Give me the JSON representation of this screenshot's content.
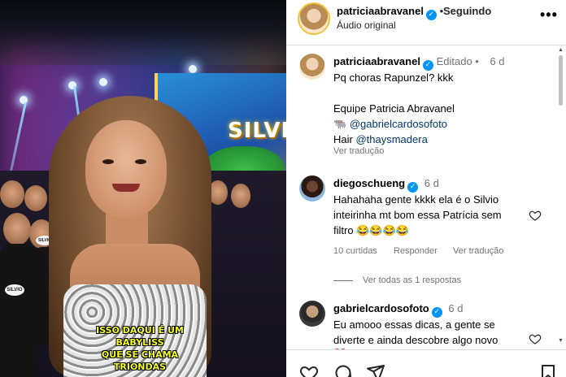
{
  "post": {
    "username": "patriciaabravanel",
    "follow_status": "Seguindo",
    "audio": "Áudio original",
    "more": "•••"
  },
  "video": {
    "sign_text": "SILVIO",
    "caption_line1": "ISSO DAQUI É UM BABYLISS",
    "caption_line2": "QUE SE CHAMA TRIONDAS",
    "badge_1": "SILVIO",
    "badge_2": "SILVIO"
  },
  "caption_comment": {
    "username": "patriciaabravanel",
    "edited": "Editado",
    "time": "6 d",
    "line1": "Pq choras Rapunzel? kkk",
    "line2": "Equipe Patricia Abravanel",
    "line3_emoji": "🐃",
    "line3_mention": "@gabrielcardosofoto",
    "line4_prefix": "Hair ",
    "line4_mention": "@thaysmadera",
    "translate": "Ver tradução"
  },
  "comments": [
    {
      "username": "diegoschueng",
      "time": "6 d",
      "line1": "Hahahaha gente kkkk ela é o Silvio",
      "line2": "inteirinha mt bom essa Patrícia sem",
      "line3": "filtro 😂😂😂😂",
      "likes": "10 curtidas",
      "reply": "Responder",
      "translate": "Ver tradução",
      "view_replies": "Ver todas as 1 respostas"
    },
    {
      "username": "gabrielcardosofoto",
      "time": "6 d",
      "line1": "Eu amooo essas dicas, a gente se",
      "line2": "diverte e ainda descobre algo novo",
      "line3": "❤️🙌"
    }
  ],
  "colors": {
    "verified": "#0095f6",
    "muted": "#737373",
    "mention": "#00376b",
    "caption_yellow": "#f6ff2a"
  }
}
